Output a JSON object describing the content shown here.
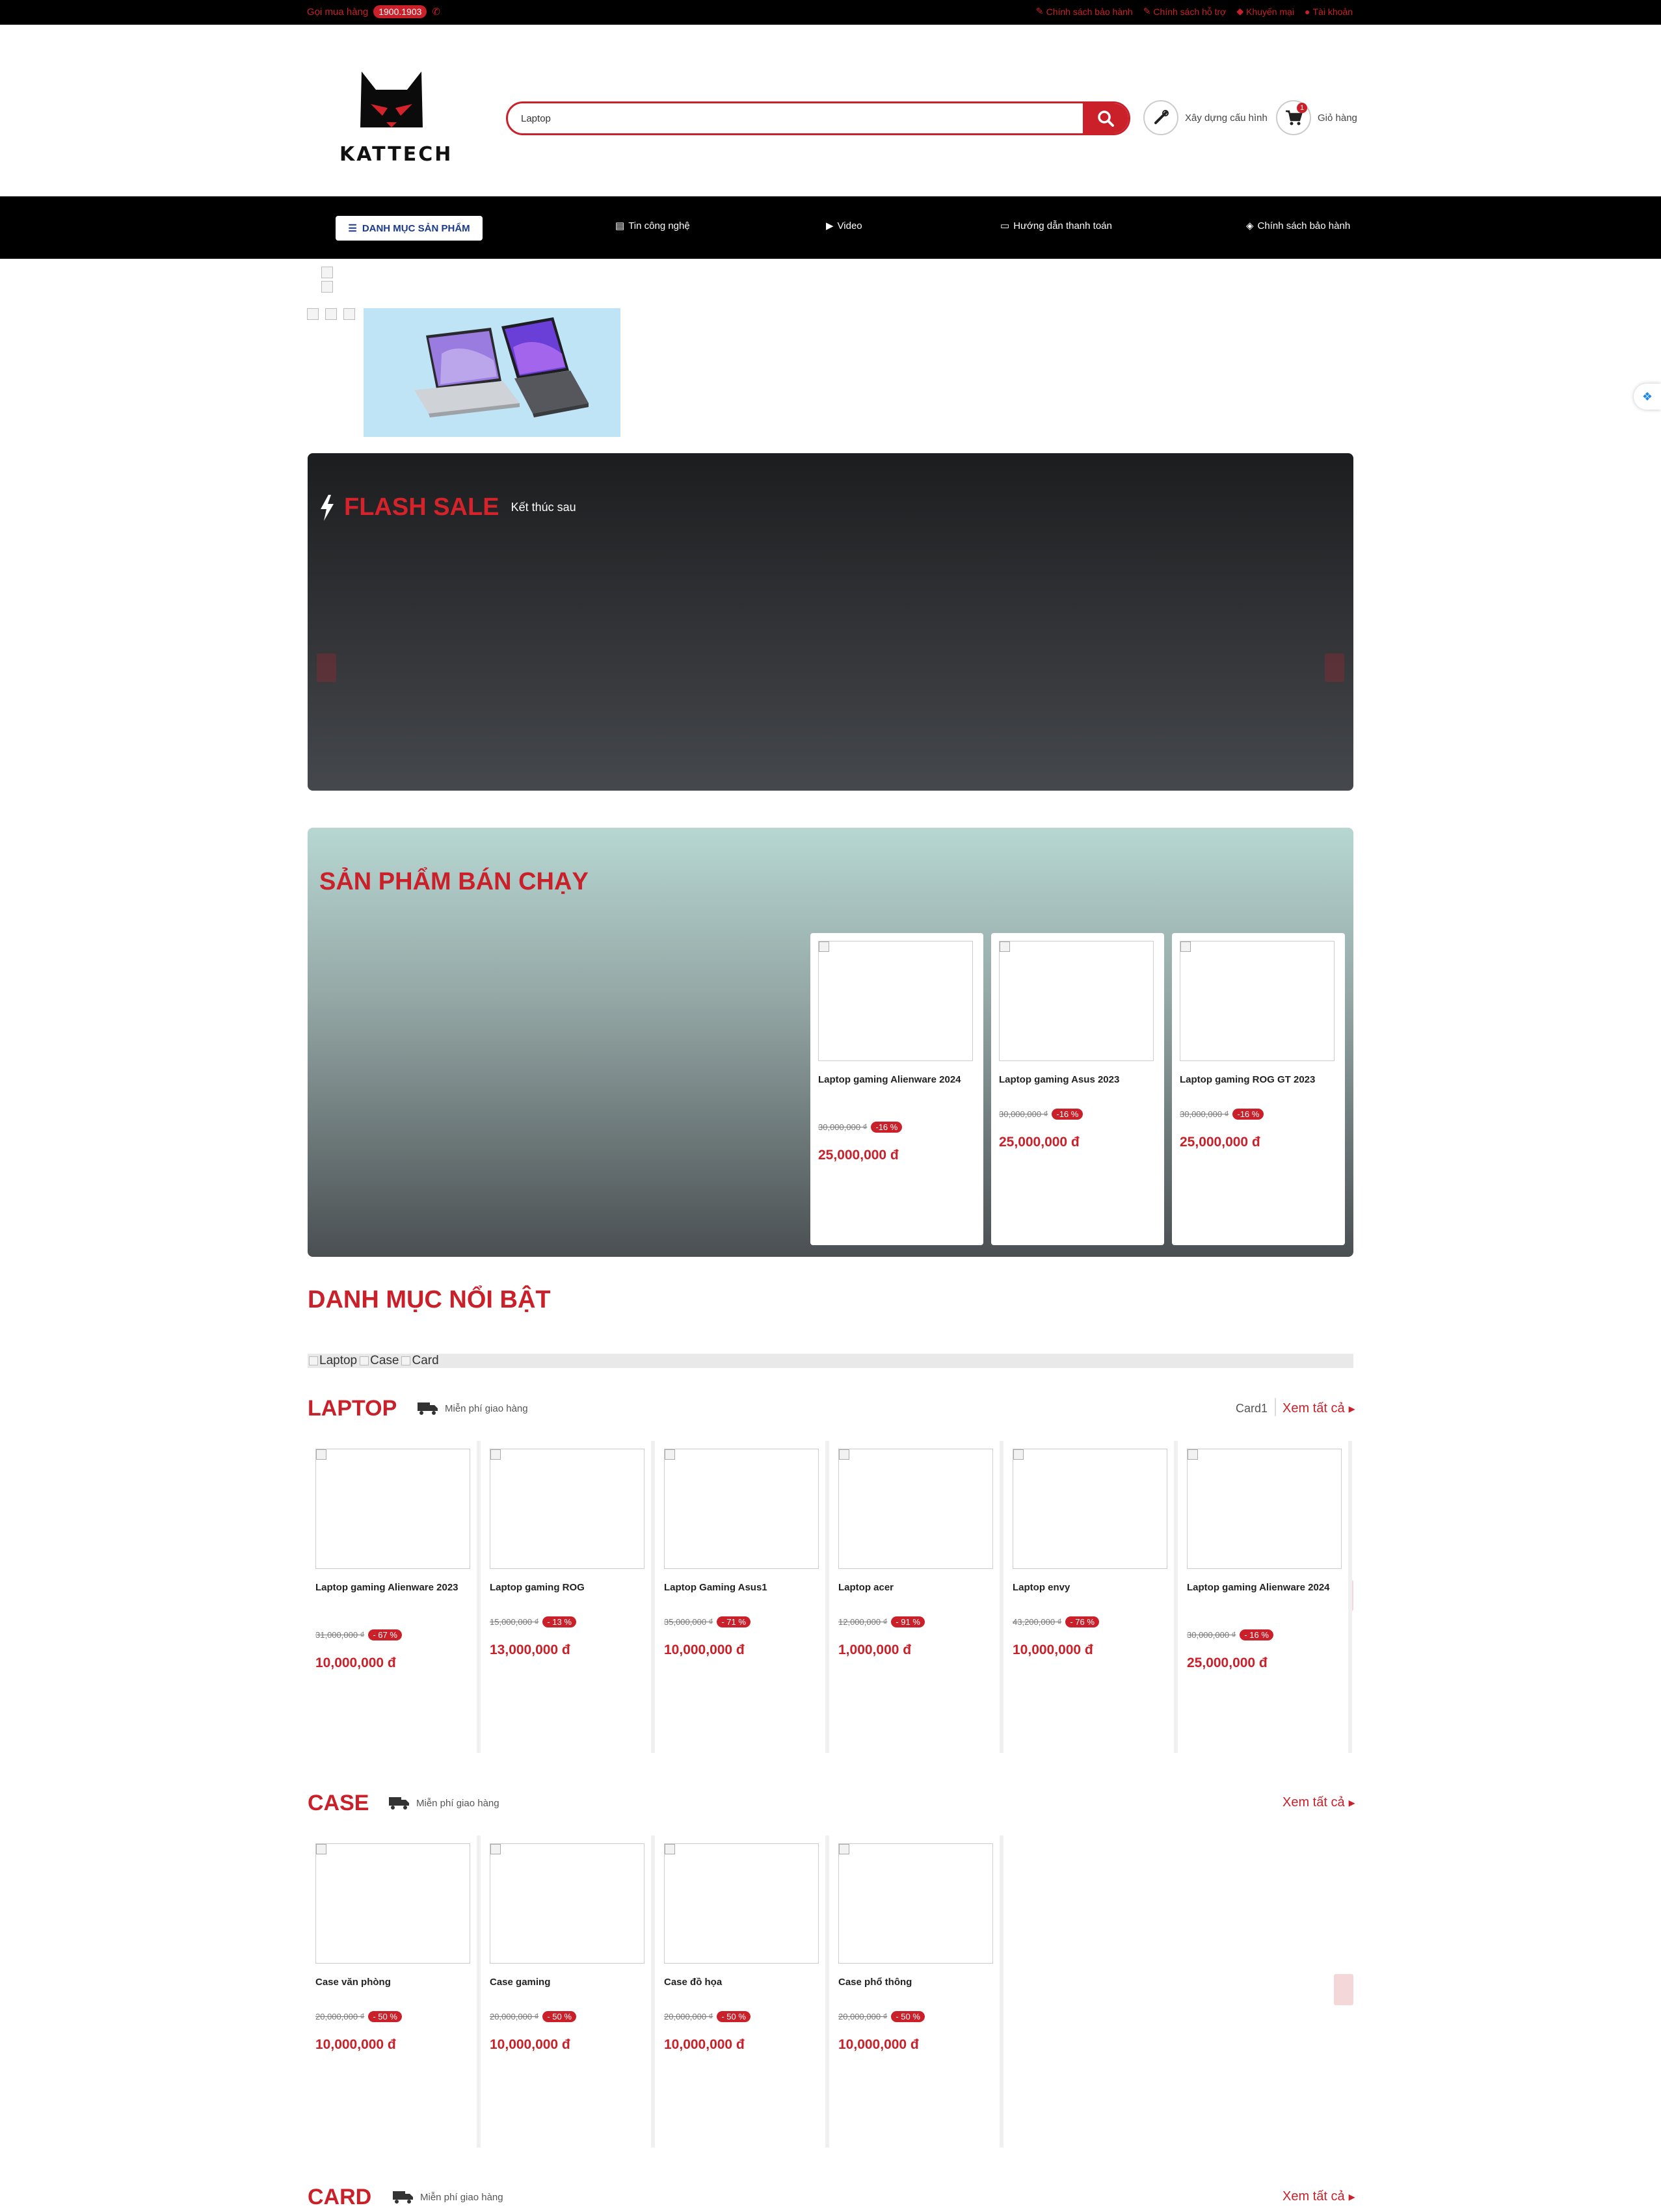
{
  "topbar": {
    "hotline_label": "Gọi mua hàng",
    "hotline_number": "1900.1903",
    "links": [
      "Chính sách bảo hành",
      "Chính sách hỗ trợ",
      "Khuyến mại",
      "Tài khoản"
    ]
  },
  "header": {
    "logo_text": "KATTECH",
    "search_value": "Laptop",
    "build_pc_label": "Xây dựng cấu hình",
    "cart_label": "Giỏ hàng",
    "cart_count": "1"
  },
  "nav": {
    "category_button": "DANH MỤC SẢN PHẨM",
    "items": [
      "Tin công nghệ",
      "Video",
      "Hướng dẫn thanh toán",
      "Chính sách bảo hành"
    ]
  },
  "flash_sale": {
    "title": "FLASH SALE",
    "subtitle": "Kết thúc sau"
  },
  "best_sellers": {
    "title": "SẢN PHẨM BÁN CHẠY",
    "products": [
      {
        "name": "Laptop gaming Alienware 2024",
        "old_price": "30,000,000 ₫",
        "discount": "-16 %",
        "price": "25,000,000 đ"
      },
      {
        "name": "Laptop gaming Asus 2023",
        "old_price": "30,000,000 ₫",
        "discount": "-16 %",
        "price": "25,000,000 đ"
      },
      {
        "name": "Laptop gaming ROG GT 2023",
        "old_price": "30,000,000 ₫",
        "discount": "-16 %",
        "price": "25,000,000 đ"
      }
    ]
  },
  "featured": {
    "title": "DANH MỤC NỔI BẬT",
    "items": [
      "Laptop",
      "Case",
      "Card"
    ]
  },
  "sections": {
    "laptop": {
      "title": "LAPTOP",
      "shipping": "Miễn phí giao hàng",
      "extra": "Card1",
      "see_all": "Xem tất cả",
      "products": [
        {
          "name": "Laptop gaming Alienware 2023",
          "old_price": "31,000,000 ₫",
          "discount": "- 67 %",
          "price": "10,000,000 đ"
        },
        {
          "name": "Laptop gaming ROG",
          "old_price": "15,000,000 ₫",
          "discount": "- 13 %",
          "price": "13,000,000 đ"
        },
        {
          "name": "Laptop Gaming Asus1",
          "old_price": "35,000,000 ₫",
          "discount": "- 71 %",
          "price": "10,000,000 đ"
        },
        {
          "name": "Laptop acer",
          "old_price": "12,000,000 ₫",
          "discount": "- 91 %",
          "price": "1,000,000 đ"
        },
        {
          "name": "Laptop envy",
          "old_price": "43,200,000 ₫",
          "discount": "- 76 %",
          "price": "10,000,000 đ"
        },
        {
          "name": "Laptop gaming Alienware 2024",
          "old_price": "30,000,000 ₫",
          "discount": "- 16 %",
          "price": "25,000,000 đ"
        }
      ]
    },
    "case": {
      "title": "CASE",
      "shipping": "Miễn phí giao hàng",
      "see_all": "Xem tất cả",
      "products": [
        {
          "name": "Case văn phòng",
          "old_price": "20,000,000 ₫",
          "discount": "- 50 %",
          "price": "10,000,000 đ"
        },
        {
          "name": "Case gaming",
          "old_price": "20,000,000 ₫",
          "discount": "- 50 %",
          "price": "10,000,000 đ"
        },
        {
          "name": "Case đồ họa",
          "old_price": "20,000,000 ₫",
          "discount": "- 50 %",
          "price": "10,000,000 đ"
        },
        {
          "name": "Case phổ thông",
          "old_price": "20,000,000 ₫",
          "discount": "- 50 %",
          "price": "10,000,000 đ"
        }
      ]
    },
    "card": {
      "title": "CARD",
      "shipping": "Miễn phí giao hàng",
      "see_all": "Xem tất cả"
    }
  },
  "colors": {
    "brand_red": "#c9202a",
    "topbar_bg": "#000000",
    "nav_bg": "#000000"
  }
}
